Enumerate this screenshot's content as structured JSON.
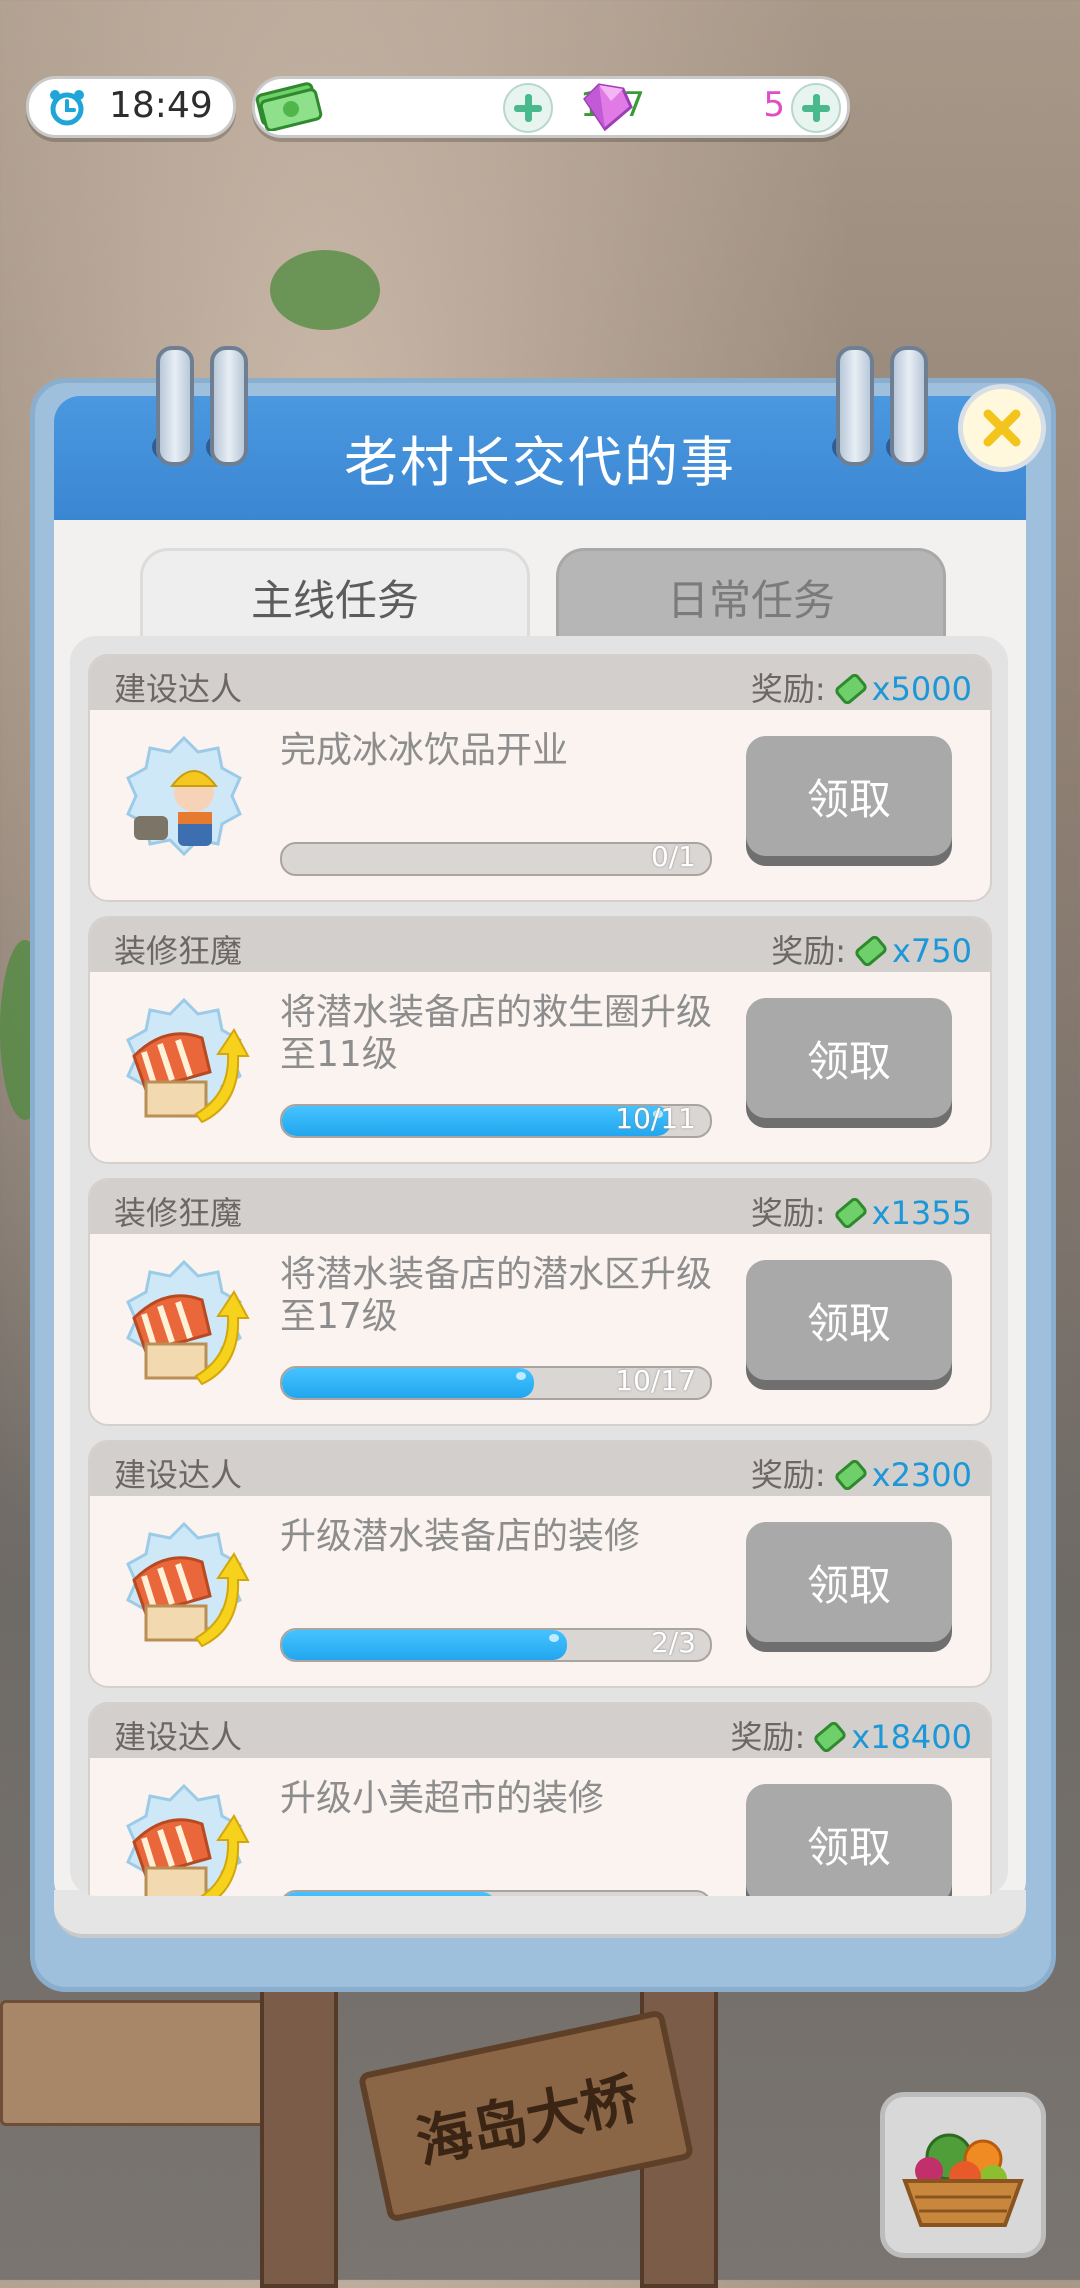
{
  "hud": {
    "time": "18:49",
    "cash": "157",
    "gems": "5"
  },
  "panel": {
    "title": "老村长交代的事",
    "tabs": [
      {
        "label": "主线任务",
        "active": true
      },
      {
        "label": "日常任务",
        "active": false
      }
    ]
  },
  "tasks": [
    {
      "category": "建设达人",
      "reward_label": "奖励:",
      "reward": "x5000",
      "desc": "完成冰冰饮品开业",
      "progress_text": "0/1",
      "progress": 0,
      "button": "领取",
      "icon": "worker-icon"
    },
    {
      "category": "装修狂魔",
      "reward_label": "奖励:",
      "reward": "x750",
      "desc": "将潜水装备店的救生圈升级至11级",
      "progress_text": "10/11",
      "progress": 0.909,
      "button": "领取",
      "icon": "shop-upgrade-icon"
    },
    {
      "category": "装修狂魔",
      "reward_label": "奖励:",
      "reward": "x1355",
      "desc": "将潜水装备店的潜水区升级至17级",
      "progress_text": "10/17",
      "progress": 0.588,
      "button": "领取",
      "icon": "shop-upgrade-icon"
    },
    {
      "category": "建设达人",
      "reward_label": "奖励:",
      "reward": "x2300",
      "desc": "升级潜水装备店的装修",
      "progress_text": "2/3",
      "progress": 0.667,
      "button": "领取",
      "icon": "shop-upgrade-icon"
    },
    {
      "category": "建设达人",
      "reward_label": "奖励:",
      "reward": "x18400",
      "desc": "升级小美超市的装修",
      "progress_text": "",
      "progress": 0.5,
      "button": "领取",
      "icon": "shop-upgrade-icon"
    }
  ],
  "background": {
    "sign_text": "海岛大桥"
  },
  "colors": {
    "header_blue": "#3b86d2",
    "progress_blue": "#22a6ee",
    "reward_blue": "#1c97d8",
    "cash_green": "#3a9a35",
    "gem_pink": "#e04ec6"
  }
}
